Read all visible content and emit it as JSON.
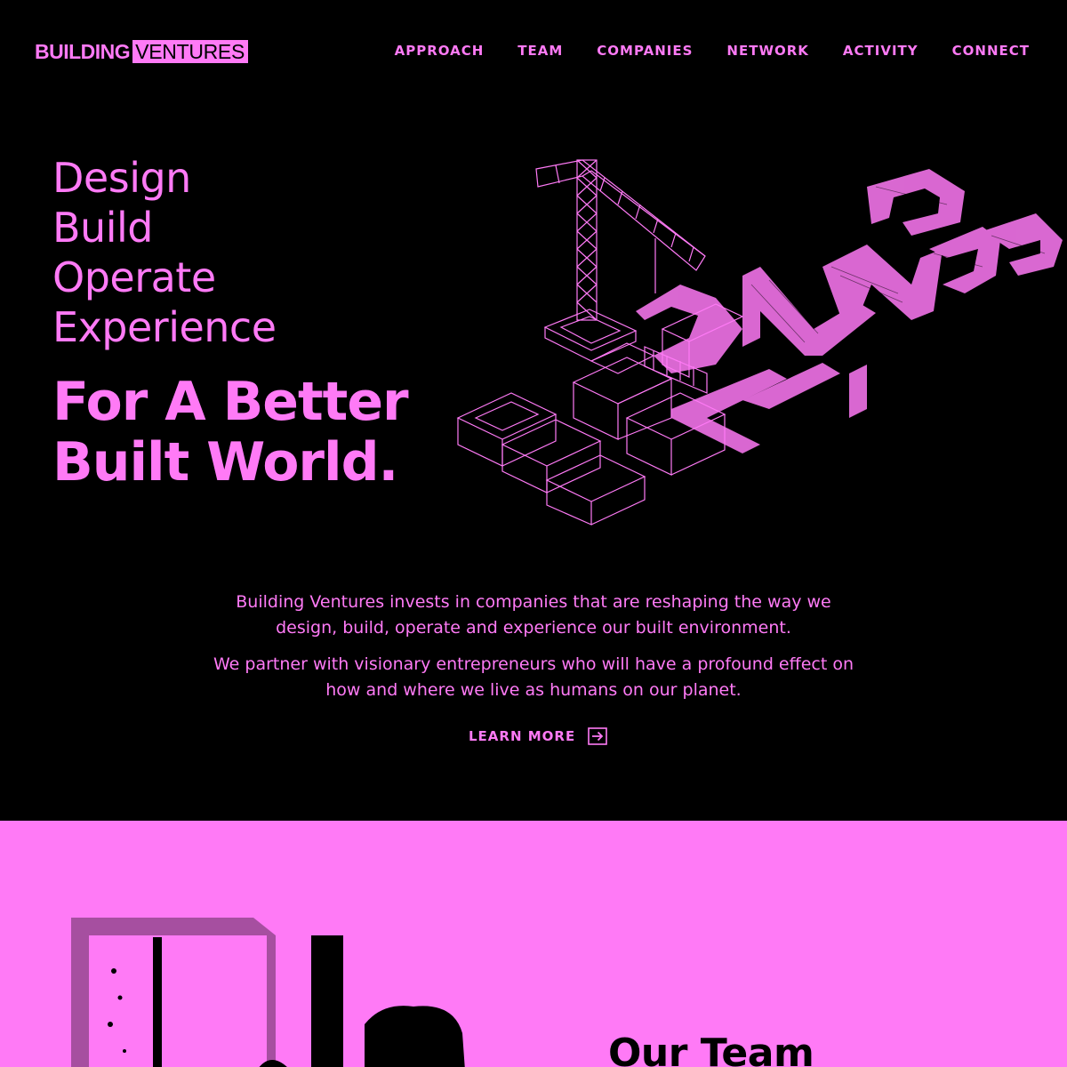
{
  "brand": {
    "logo_bold": "BUILDING",
    "logo_boxed": "VENTURES",
    "accent": "#ff7af6",
    "background": "#000000"
  },
  "nav": {
    "items": [
      "APPROACH",
      "TEAM",
      "COMPANIES",
      "NETWORK",
      "ACTIVITY",
      "CONNECT"
    ]
  },
  "hero": {
    "words": [
      "Design",
      "Build",
      "Operate",
      "Experience"
    ],
    "tagline_line1": "For A Better",
    "tagline_line2": "Built World.",
    "illustration_icon": "isometric-crane-lettering-icon"
  },
  "intro": {
    "p1": "Building Ventures invests in companies that are reshaping the way we design, build, operate and experience our built environment.",
    "p2": "We partner with visionary entrepreneurs who will have a profound effect on how and where we live as humans on our planet.",
    "cta": "LEARN MORE",
    "cta_icon": "arrow-right-icon"
  },
  "team": {
    "title": "Our Team"
  }
}
